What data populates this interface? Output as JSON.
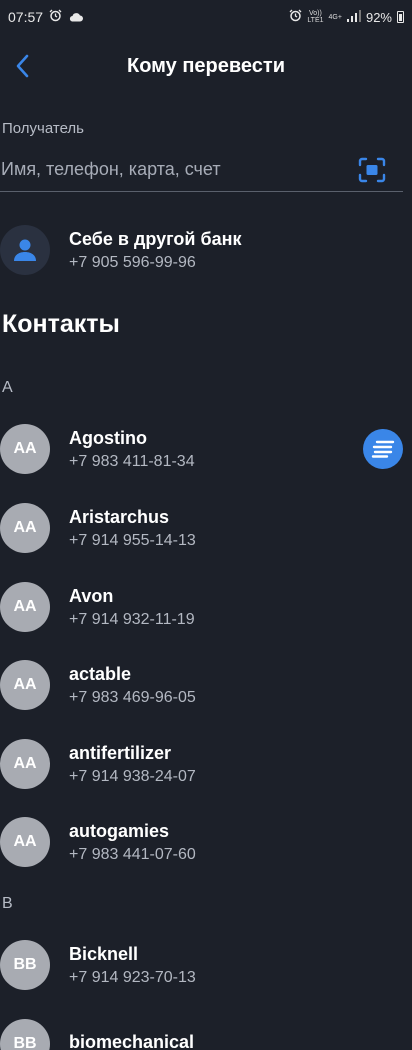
{
  "status_bar": {
    "time": "07:57",
    "network_top": "Vo))",
    "network_bottom": "LTE1",
    "net_type": "4G+",
    "battery": "92%"
  },
  "header": {
    "title": "Кому перевести"
  },
  "recipient": {
    "label": "Получатель",
    "placeholder": "Имя, телефон, карта, счет",
    "value": ""
  },
  "self_transfer": {
    "name": "Себе в другой банк",
    "phone": "+7 905 596-99-96"
  },
  "contacts_title": "Контакты",
  "groups": [
    {
      "letter": "A",
      "contacts": [
        {
          "initials": "AA",
          "name": "Agostino",
          "phone": "+7 983 411-81-34"
        },
        {
          "initials": "AA",
          "name": "Aristarchus",
          "phone": "+7 914 955-14-13"
        },
        {
          "initials": "AA",
          "name": "Avon",
          "phone": "+7 914 932-11-19"
        },
        {
          "initials": "AA",
          "name": "actable",
          "phone": "+7 983 469-96-05"
        },
        {
          "initials": "AA",
          "name": "antifertilizer",
          "phone": "+7 914 938-24-07"
        },
        {
          "initials": "AA",
          "name": "autogamies",
          "phone": "+7 983 441-07-60"
        }
      ]
    },
    {
      "letter": "B",
      "contacts": [
        {
          "initials": "BB",
          "name": "Bicknell",
          "phone": "+7 914 923-70-13"
        },
        {
          "initials": "BB",
          "name": "biomechanical",
          "phone": ""
        }
      ]
    }
  ],
  "colors": {
    "background": "#1c2029",
    "accent": "#3a86e8",
    "avatar": "#a8abb2"
  }
}
